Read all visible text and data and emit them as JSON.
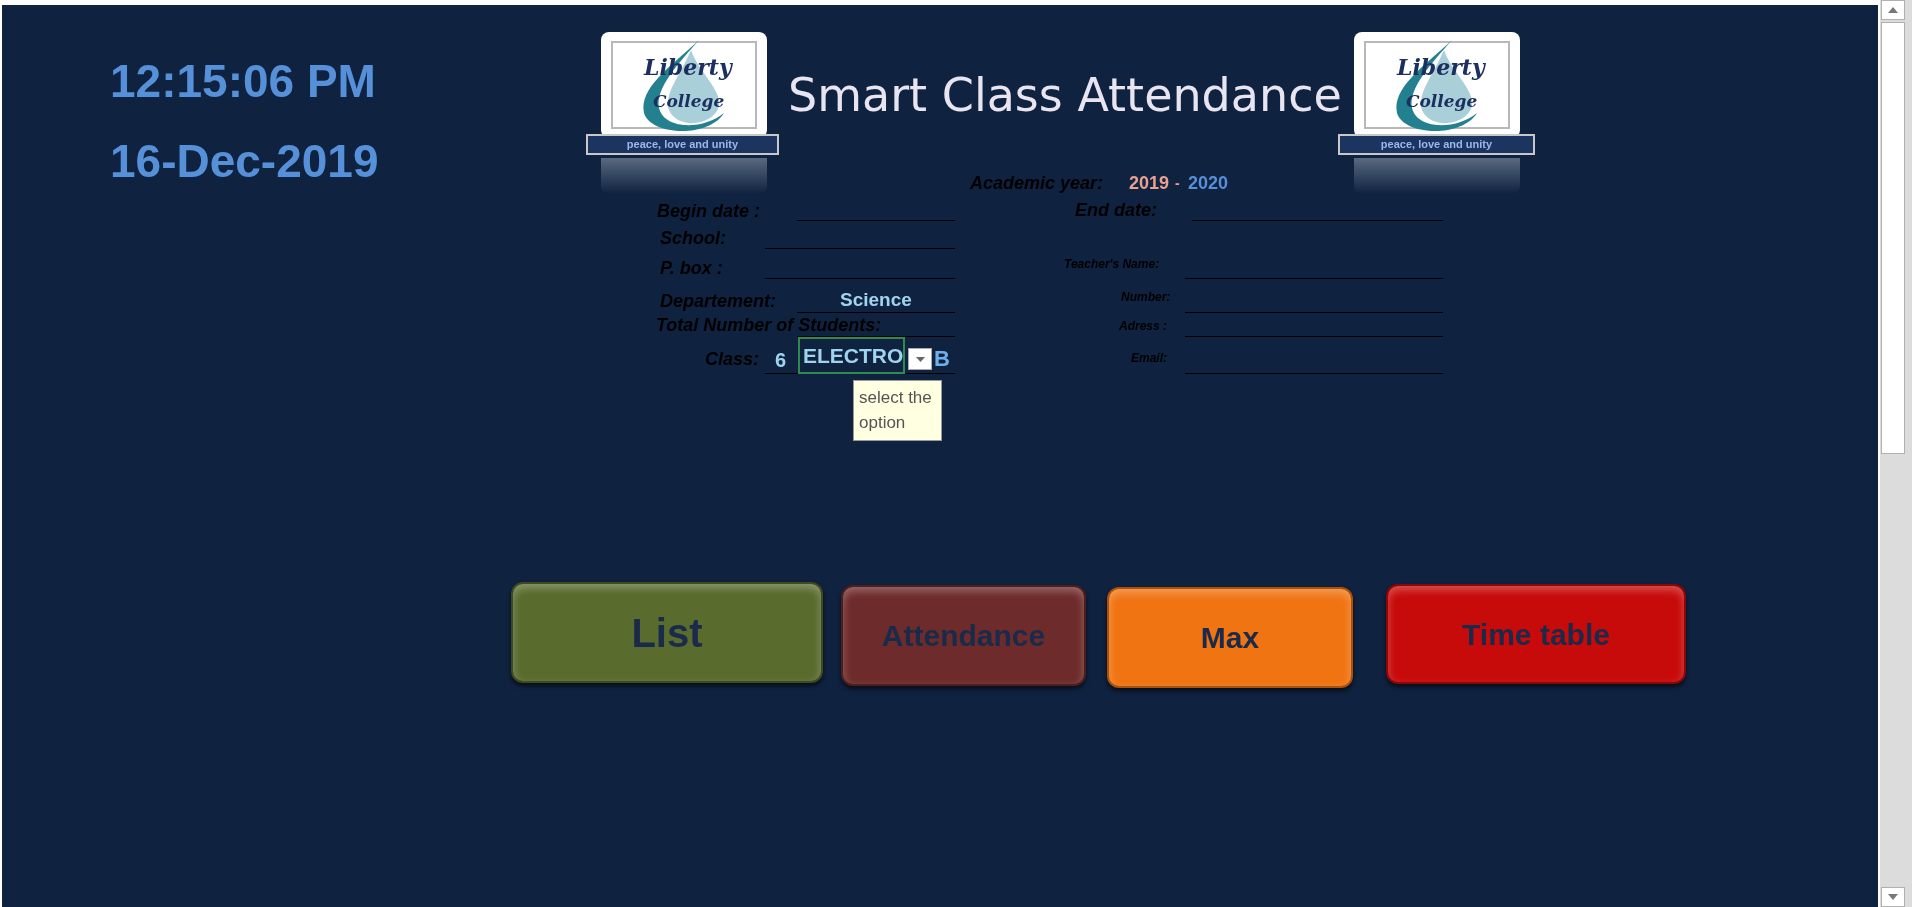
{
  "clock": {
    "time": "12:15:06 PM",
    "date": "16-Dec-2019"
  },
  "logos": [
    {
      "name_line_1": "Liberty",
      "name_line_2": "College",
      "motto": "peace, love and unity"
    },
    {
      "name_line_1": "Liberty",
      "name_line_2": "College",
      "motto": "peace, love and unity"
    }
  ],
  "title": "Smart Class Attendance",
  "academic_year": {
    "label": "Academic year:",
    "start": "2019",
    "separator": "-",
    "end": "2020"
  },
  "form_left": [
    {
      "label": "Begin date  :"
    },
    {
      "label": "School:"
    },
    {
      "label": "P. box   :"
    },
    {
      "label": "Departement:",
      "value": "Science"
    },
    {
      "label": "Total Number of Students:"
    }
  ],
  "class_row": {
    "label": "Class:",
    "grade": "6",
    "stream": "ELECTRO",
    "section": "B",
    "tooltip": "select the option"
  },
  "form_right": [
    {
      "label": "End date:",
      "kind": "large"
    },
    {
      "label": "Teacher's Name:",
      "kind": "small"
    },
    {
      "label": "Number:",
      "kind": "small"
    },
    {
      "label": "Adress :",
      "kind": "small"
    },
    {
      "label": "Email:",
      "kind": "small"
    }
  ],
  "buttons": [
    {
      "label": "List",
      "color": "#5a6b2e"
    },
    {
      "label": "Attendance",
      "color": "#6e2b2b"
    },
    {
      "label": "Max",
      "color": "#f07412"
    },
    {
      "label": "Time table",
      "color": "#c70a0a"
    }
  ]
}
